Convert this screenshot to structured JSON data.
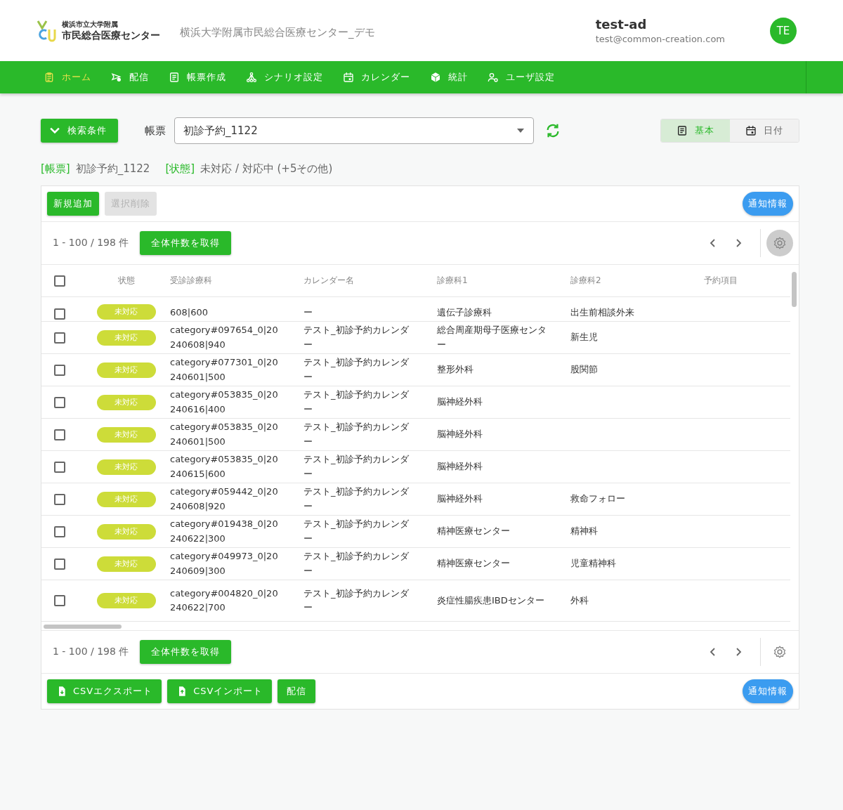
{
  "header": {
    "logo_small": "横浜市立大学附属",
    "logo_large": "市民総合医療センター",
    "site_title": "横浜大学附属市民総合医療センター_デモ",
    "user_name": "test-ad",
    "user_email": "test@common-creation.com",
    "avatar": "TE"
  },
  "nav": [
    {
      "label": "ホーム",
      "selected": true
    },
    {
      "label": "配信",
      "selected": false
    },
    {
      "label": "帳票作成",
      "selected": false
    },
    {
      "label": "シナリオ設定",
      "selected": false
    },
    {
      "label": "カレンダー",
      "selected": false
    },
    {
      "label": "統計",
      "selected": false
    },
    {
      "label": "ユーザ設定",
      "selected": false
    }
  ],
  "toolbar": {
    "search_button": "検索条件",
    "form_label": "帳票",
    "form_value": "初診予約_1122",
    "views": [
      {
        "label": "基本",
        "selected": true
      },
      {
        "label": "日付",
        "selected": false
      }
    ]
  },
  "filters": [
    {
      "key": "[帳票]",
      "value": "初診予約_1122"
    },
    {
      "key": "[状態]",
      "value": "未対応 / 対応中 (+5その他)"
    }
  ],
  "actions": {
    "add": {
      "label": "新規追加",
      "disabled": false
    },
    "delete": {
      "label": "選択削除",
      "disabled": true
    },
    "notify": "通知情報"
  },
  "pager_top": {
    "range": "1 - 100 / 198 件",
    "fetch_all": "全体件数を取得"
  },
  "table": {
    "select_all_checked": false,
    "columns": [
      "状態",
      "受診診療科",
      "カレンダー名",
      "診療科1",
      "診療科2",
      "予約項目"
    ],
    "rows": [
      {
        "checked": false,
        "status": "未対応",
        "category": "608|600",
        "calendar": "ー",
        "dept1": "遺伝子診療科",
        "dept2": "出生前相談外来",
        "partial": true
      },
      {
        "checked": false,
        "status": "未対応",
        "category": "category#097654_0|20240608|940",
        "calendar": "テスト_初診予約カレンダー",
        "dept1": "総合周産期母子医療センター",
        "dept2": "新生児",
        "partial": false
      },
      {
        "checked": false,
        "status": "未対応",
        "category": "category#077301_0|20240601|500",
        "calendar": "テスト_初診予約カレンダー",
        "dept1": "整形外科",
        "dept2": "股関節",
        "partial": false
      },
      {
        "checked": false,
        "status": "未対応",
        "category": "category#053835_0|20240616|400",
        "calendar": "テスト_初診予約カレンダー",
        "dept1": "脳神経外科",
        "partial": false
      },
      {
        "checked": false,
        "status": "未対応",
        "category": "category#053835_0|20240601|500",
        "calendar": "テスト_初診予約カレンダー",
        "dept1": "脳神経外科",
        "partial": false
      },
      {
        "checked": false,
        "status": "未対応",
        "category": "category#053835_0|20240615|600",
        "calendar": "テスト_初診予約カレンダー",
        "dept1": "脳神経外科",
        "partial": false
      },
      {
        "checked": false,
        "status": "未対応",
        "category": "category#059442_0|20240608|920",
        "calendar": "テスト_初診予約カレンダー",
        "dept1": "脳神経外科",
        "dept2": "救命フォロー",
        "partial": false
      },
      {
        "checked": false,
        "status": "未対応",
        "category": "category#019438_0|20240622|300",
        "calendar": "テスト_初診予約カレンダー",
        "dept1": "精神医療センター",
        "dept2": "精神科",
        "partial": false
      },
      {
        "checked": false,
        "status": "未対応",
        "category": "category#049973_0|20240609|300",
        "calendar": "テスト_初診予約カレンダー",
        "dept1": "精神医療センター",
        "dept2": "児童精神科",
        "partial": false
      },
      {
        "checked": false,
        "status": "未対応",
        "category": "category#004820_0|20240622|700",
        "calendar": "テスト_初診予約カレンダー",
        "dept1": "炎症性腸疾患IBDセンター",
        "dept2": "外科",
        "partial": false
      }
    ]
  },
  "pager_bottom": {
    "range": "1 - 100 / 198 件",
    "fetch_all": "全体件数を取得"
  },
  "footer_actions": [
    {
      "label": "CSVエクスポート"
    },
    {
      "label": "CSVインポート"
    },
    {
      "label": "配信"
    }
  ],
  "footer_notify": "通知情報"
}
